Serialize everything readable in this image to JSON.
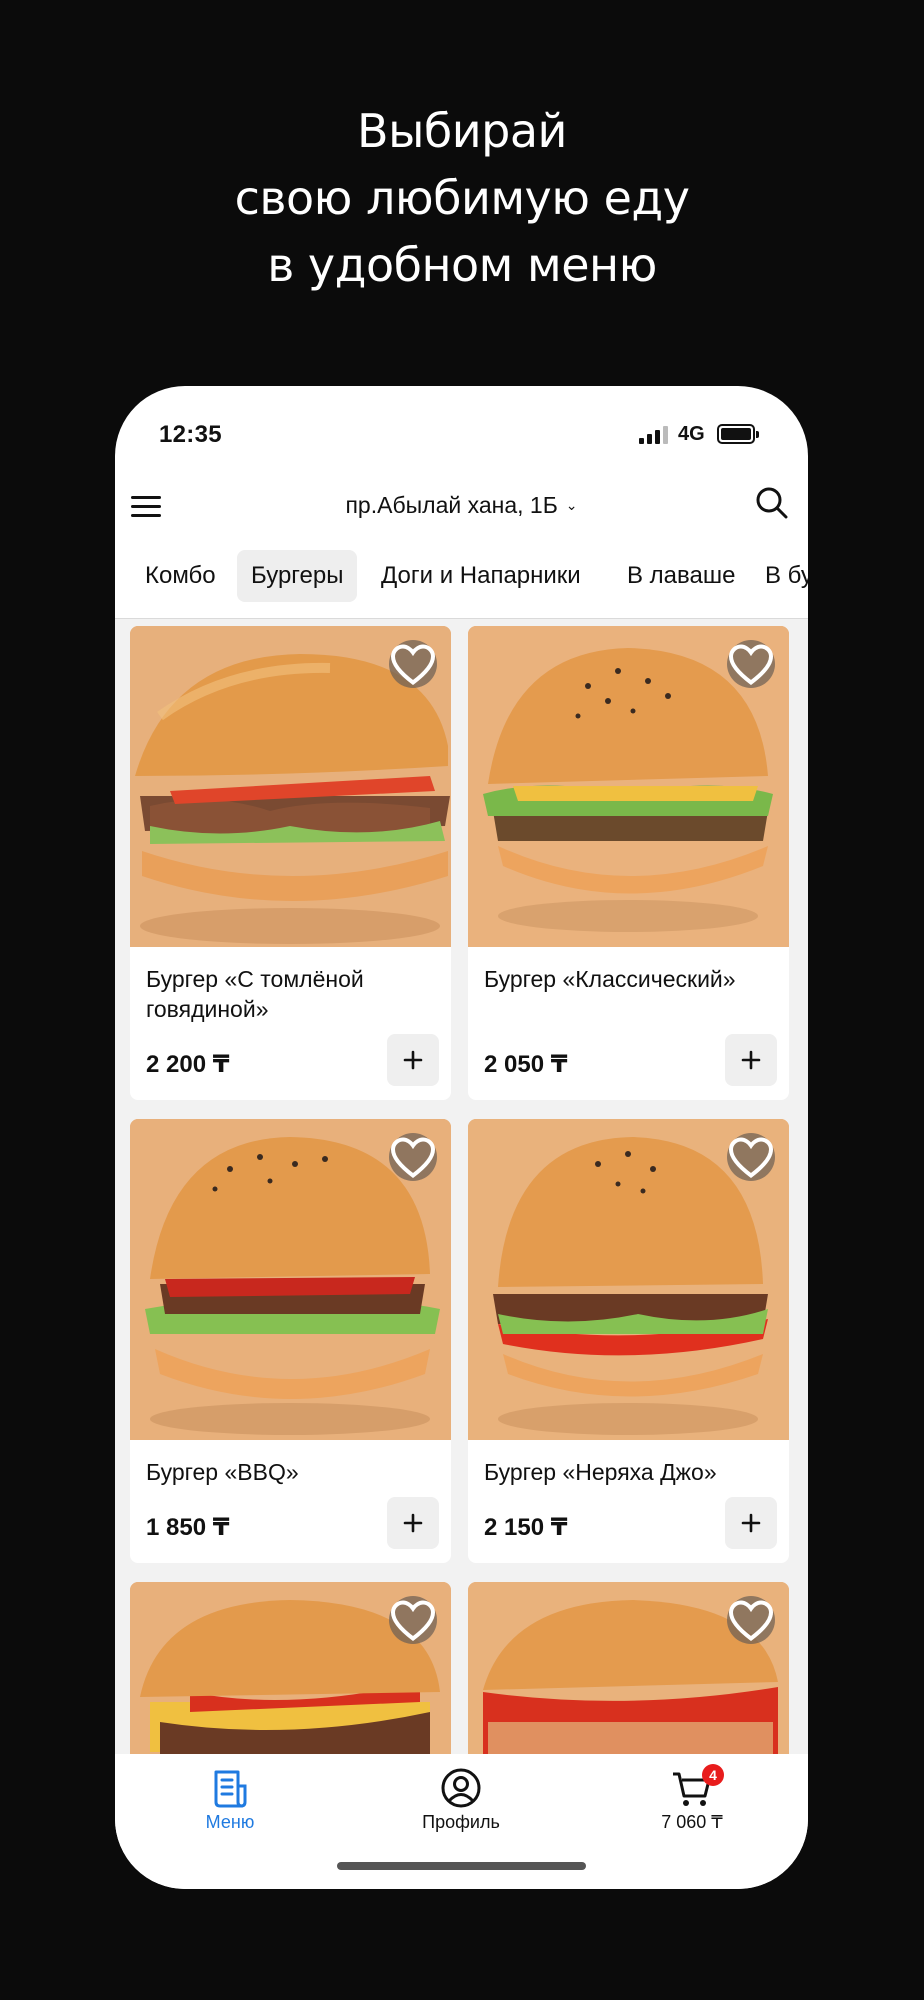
{
  "promo": {
    "line1": "Выбирай",
    "line2": "свою любимую еду",
    "line3": "в удобном меню"
  },
  "status": {
    "time": "12:35",
    "network": "4G"
  },
  "header": {
    "address": "пр.Абылай хана, 1Б"
  },
  "tabs": [
    {
      "label": "Комбо",
      "active": false
    },
    {
      "label": "Бургеры",
      "active": true
    },
    {
      "label": "Доги и Напарники",
      "active": false
    },
    {
      "label": "В лаваше",
      "active": false
    },
    {
      "label": "В бу",
      "active": false
    }
  ],
  "products": [
    {
      "name": "Бургер «С томлёной говядиной»",
      "price": "2 200 ₸"
    },
    {
      "name": "Бургер «Классический»",
      "price": "2 050 ₸"
    },
    {
      "name": "Бургер «BBQ»",
      "price": "1 850 ₸"
    },
    {
      "name": "Бургер «Неряха Джо»",
      "price": "2 150 ₸"
    }
  ],
  "tabbar": {
    "menu_label": "Меню",
    "profile_label": "Профиль",
    "cart_total": "7 060 ₸",
    "cart_count": "4"
  },
  "colors": {
    "accent": "#1f7ae0",
    "badge": "#e81c1c",
    "image_bg": "#e9b683"
  }
}
